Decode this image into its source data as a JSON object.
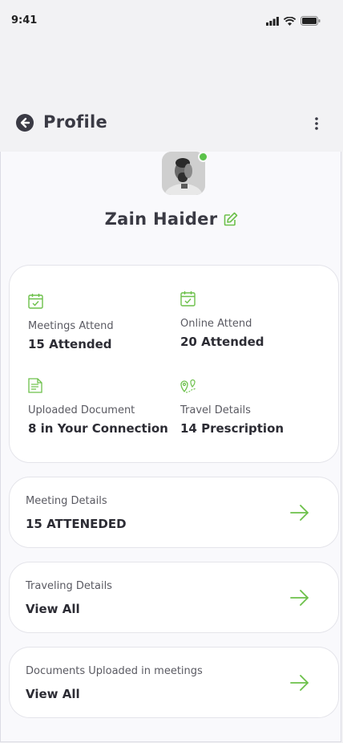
{
  "status": {
    "time": "9:41"
  },
  "header": {
    "title": "Profile"
  },
  "profile": {
    "name": "Zain Haider"
  },
  "stats": [
    {
      "label": "Meetings Attend",
      "value": "15 Attended",
      "icon": "calendar-check-icon"
    },
    {
      "label": "Online Attend",
      "value": "20 Attended",
      "icon": "calendar-check-icon"
    },
    {
      "label": "Uploaded Document",
      "value": "8 in Your Connection",
      "icon": "document-icon"
    },
    {
      "label": "Travel Details",
      "value": "14 Prescription",
      "icon": "travel-location-icon"
    }
  ],
  "rows": [
    {
      "label": "Meeting Details",
      "value": "15 ATTENEDED"
    },
    {
      "label": "Traveling Details",
      "value": "View All"
    },
    {
      "label": "Documents Uploaded in meetings",
      "value": "View All"
    }
  ],
  "colors": {
    "accent": "#6cc04a",
    "online": "#5bc24a",
    "text": "#2f2f37"
  }
}
